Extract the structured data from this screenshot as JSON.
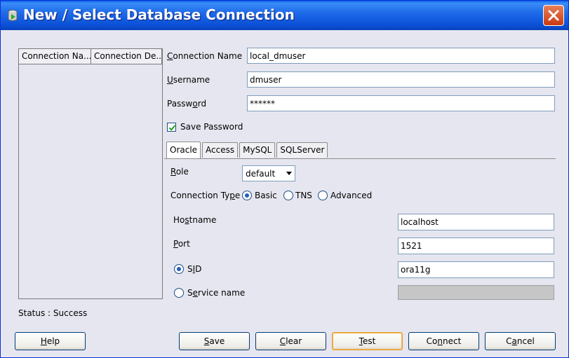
{
  "window": {
    "title": "New / Select Database Connection"
  },
  "connections_list": {
    "columns": [
      "Connection Na...",
      "Connection De..."
    ],
    "rows": []
  },
  "form": {
    "connection_name_label": "Connection Name",
    "connection_name_value": "local_dmuser",
    "username_label": "Username",
    "username_value": "dmuser",
    "password_label": "Password",
    "password_value": "******",
    "save_password_label": "Save Password",
    "save_password_checked": true
  },
  "tabs": [
    "Oracle",
    "Access",
    "MySQL",
    "SQLServer"
  ],
  "active_tab": "Oracle",
  "oracle": {
    "role_label": "Role",
    "role_value": "default",
    "connection_type_label": "Connection Type",
    "connection_types": [
      "Basic",
      "TNS",
      "Advanced"
    ],
    "connection_type_selected": "Basic",
    "hostname_label": "Hostname",
    "hostname_value": "localhost",
    "port_label": "Port",
    "port_value": "1521",
    "sid_label": "SID",
    "sid_value": "ora11g",
    "service_name_label": "Service name",
    "service_name_value": "",
    "selected_identifier": "SID"
  },
  "status": {
    "text": "Status : Success"
  },
  "buttons": {
    "help": "Help",
    "save": "Save",
    "clear": "Clear",
    "test": "Test",
    "connect": "Connect",
    "cancel": "Cancel"
  },
  "colors": {
    "titlebar": "#0A4FD6",
    "dialog_bg": "#E6E6F0",
    "close_button": "#D04A1E",
    "focus_border": "#F8B33F"
  },
  "icons": {
    "window": "database-icon",
    "close": "close-icon",
    "check": "check-icon",
    "dropdown": "chevron-down-icon"
  }
}
